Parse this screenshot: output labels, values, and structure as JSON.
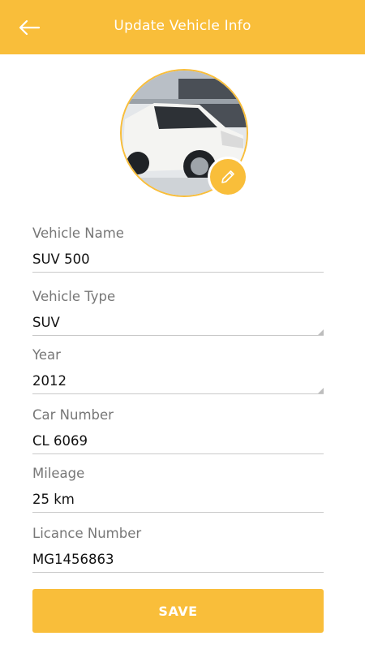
{
  "header": {
    "title": "Update Vehicle Info",
    "back_icon": "arrow-left-icon"
  },
  "vehicle_photo": {
    "edit_icon": "pencil-icon"
  },
  "form": {
    "fields": [
      {
        "label": "Vehicle Name",
        "value": "SUV 500"
      },
      {
        "label": "Vehicle Type",
        "value": "SUV"
      },
      {
        "label": "Year",
        "value": "2012"
      },
      {
        "label": "Car Number",
        "value": "CL 6069"
      },
      {
        "label": "Mileage",
        "value": "25 km"
      },
      {
        "label": "Licance Number",
        "value": "MG1456863"
      }
    ]
  },
  "save_button": {
    "label": "SAVE"
  },
  "colors": {
    "accent": "#F9BE3A",
    "label": "#777777",
    "value": "#111111",
    "underline": "#c9c9c9"
  }
}
